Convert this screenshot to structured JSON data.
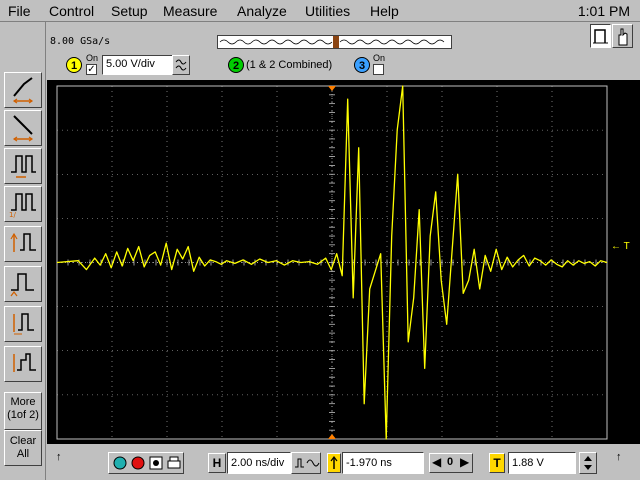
{
  "menu": {
    "file": "File",
    "control": "Control",
    "setup": "Setup",
    "measure": "Measure",
    "analyze": "Analyze",
    "utilities": "Utilities",
    "help": "Help",
    "clock": "1:01 PM"
  },
  "acquisition": {
    "sample_rate": "8.00 GSa/s"
  },
  "channels": {
    "ch1_number": "1",
    "ch1_on": "On",
    "ch1_scale": "5.00 V/div",
    "ch2_number": "2",
    "ch2_label": "(1 & 2 Combined)",
    "ch3_number": "3",
    "ch3_on": "On"
  },
  "sidebar": {
    "more_label": "More",
    "more_page": "(1of 2)",
    "clear_label": "Clear",
    "all_label": "All"
  },
  "markers": {
    "trigger_level": "← T"
  },
  "timebase": {
    "h_label": "H",
    "scale": "2.00 ns/div",
    "delay": "-1.970 ns",
    "delay_ref": "0",
    "trigger_label": "T",
    "trigger_level": "1.88 V"
  },
  "colors": {
    "trace": "#ffff00",
    "ch1": "#ffff00",
    "ch2": "#00cc00",
    "ch3": "#3aa0ff",
    "grid": "#c0c0c0",
    "trigger_marker": "#ff8000"
  },
  "chart_data": {
    "type": "line",
    "title": "",
    "xlabel": "",
    "ylabel": "",
    "grid": true,
    "divisions_x": 10,
    "divisions_y": 8,
    "xlim": [
      -11.97,
      8.03
    ],
    "ylim": [
      -20,
      20
    ],
    "x_units": "ns",
    "y_units": "V",
    "series": [
      {
        "x": [
          -11.97,
          -11.2,
          -10.9,
          -10.6,
          -10.4,
          -10.2,
          -10.0,
          -9.8,
          -9.6,
          -9.4,
          -9.2,
          -9.0,
          -8.8,
          -8.6,
          -8.4,
          -8.2,
          -8.0,
          -7.8,
          -7.6,
          -7.4,
          -7.2,
          -7.0,
          -6.8,
          -6.6,
          -6.4,
          -6.2,
          -6.0,
          -5.8,
          -5.5,
          -5.2,
          -4.9,
          -4.6,
          -4.3,
          -4.0,
          -3.7,
          -3.4,
          -3.1,
          -2.8,
          -2.5,
          -2.2,
          -2.0,
          -1.8,
          -1.6,
          -1.4,
          -1.2,
          -1.0,
          -0.8,
          -0.6,
          -0.4,
          -0.2,
          0.0,
          0.2,
          0.4,
          0.6,
          0.8,
          1.0,
          1.2,
          1.4,
          1.6,
          1.8,
          2.0,
          2.2,
          2.4,
          2.6,
          2.8,
          3.0,
          3.2,
          3.4,
          3.6,
          3.8,
          4.0,
          4.2,
          4.4,
          4.6,
          4.8,
          5.0,
          5.2,
          5.4,
          5.6,
          5.8,
          6.0,
          6.2,
          6.4,
          6.6,
          6.8,
          7.0,
          7.2,
          7.4,
          7.6,
          7.8,
          8.03
        ],
        "y": [
          0.0,
          0.2,
          -0.8,
          0.5,
          -0.3,
          1.0,
          -0.6,
          1.2,
          -0.4,
          1.6,
          0.2,
          1.8,
          -0.5,
          0.8,
          1.2,
          -0.3,
          2.2,
          -0.8,
          1.5,
          0.4,
          1.8,
          -1.0,
          0.6,
          -0.4,
          0.3,
          0.1,
          -0.2,
          0.2,
          -0.1,
          0.3,
          -0.2,
          0.4,
          0.0,
          0.2,
          -0.3,
          0.2,
          0.0,
          0.1,
          -0.2,
          0.5,
          -0.8,
          1.0,
          -1.5,
          18.5,
          -4.0,
          13.0,
          -16.0,
          -3.0,
          -1.0,
          1.0,
          -20.0,
          3.0,
          15.0,
          20.0,
          -9.0,
          -4.0,
          6.0,
          -12.0,
          3.0,
          8.0,
          -2.0,
          -7.0,
          1.5,
          10.0,
          -3.5,
          -2.0,
          1.5,
          -3.0,
          0.8,
          -1.0,
          1.5,
          -0.8,
          0.6,
          -0.5,
          0.3,
          0.8,
          -0.4,
          0.5,
          0.2,
          -0.3,
          0.3,
          -0.2,
          -0.5,
          0.2,
          -0.3,
          0.2,
          -0.1,
          0.1,
          -0.4,
          0.2,
          0.0
        ]
      }
    ]
  }
}
